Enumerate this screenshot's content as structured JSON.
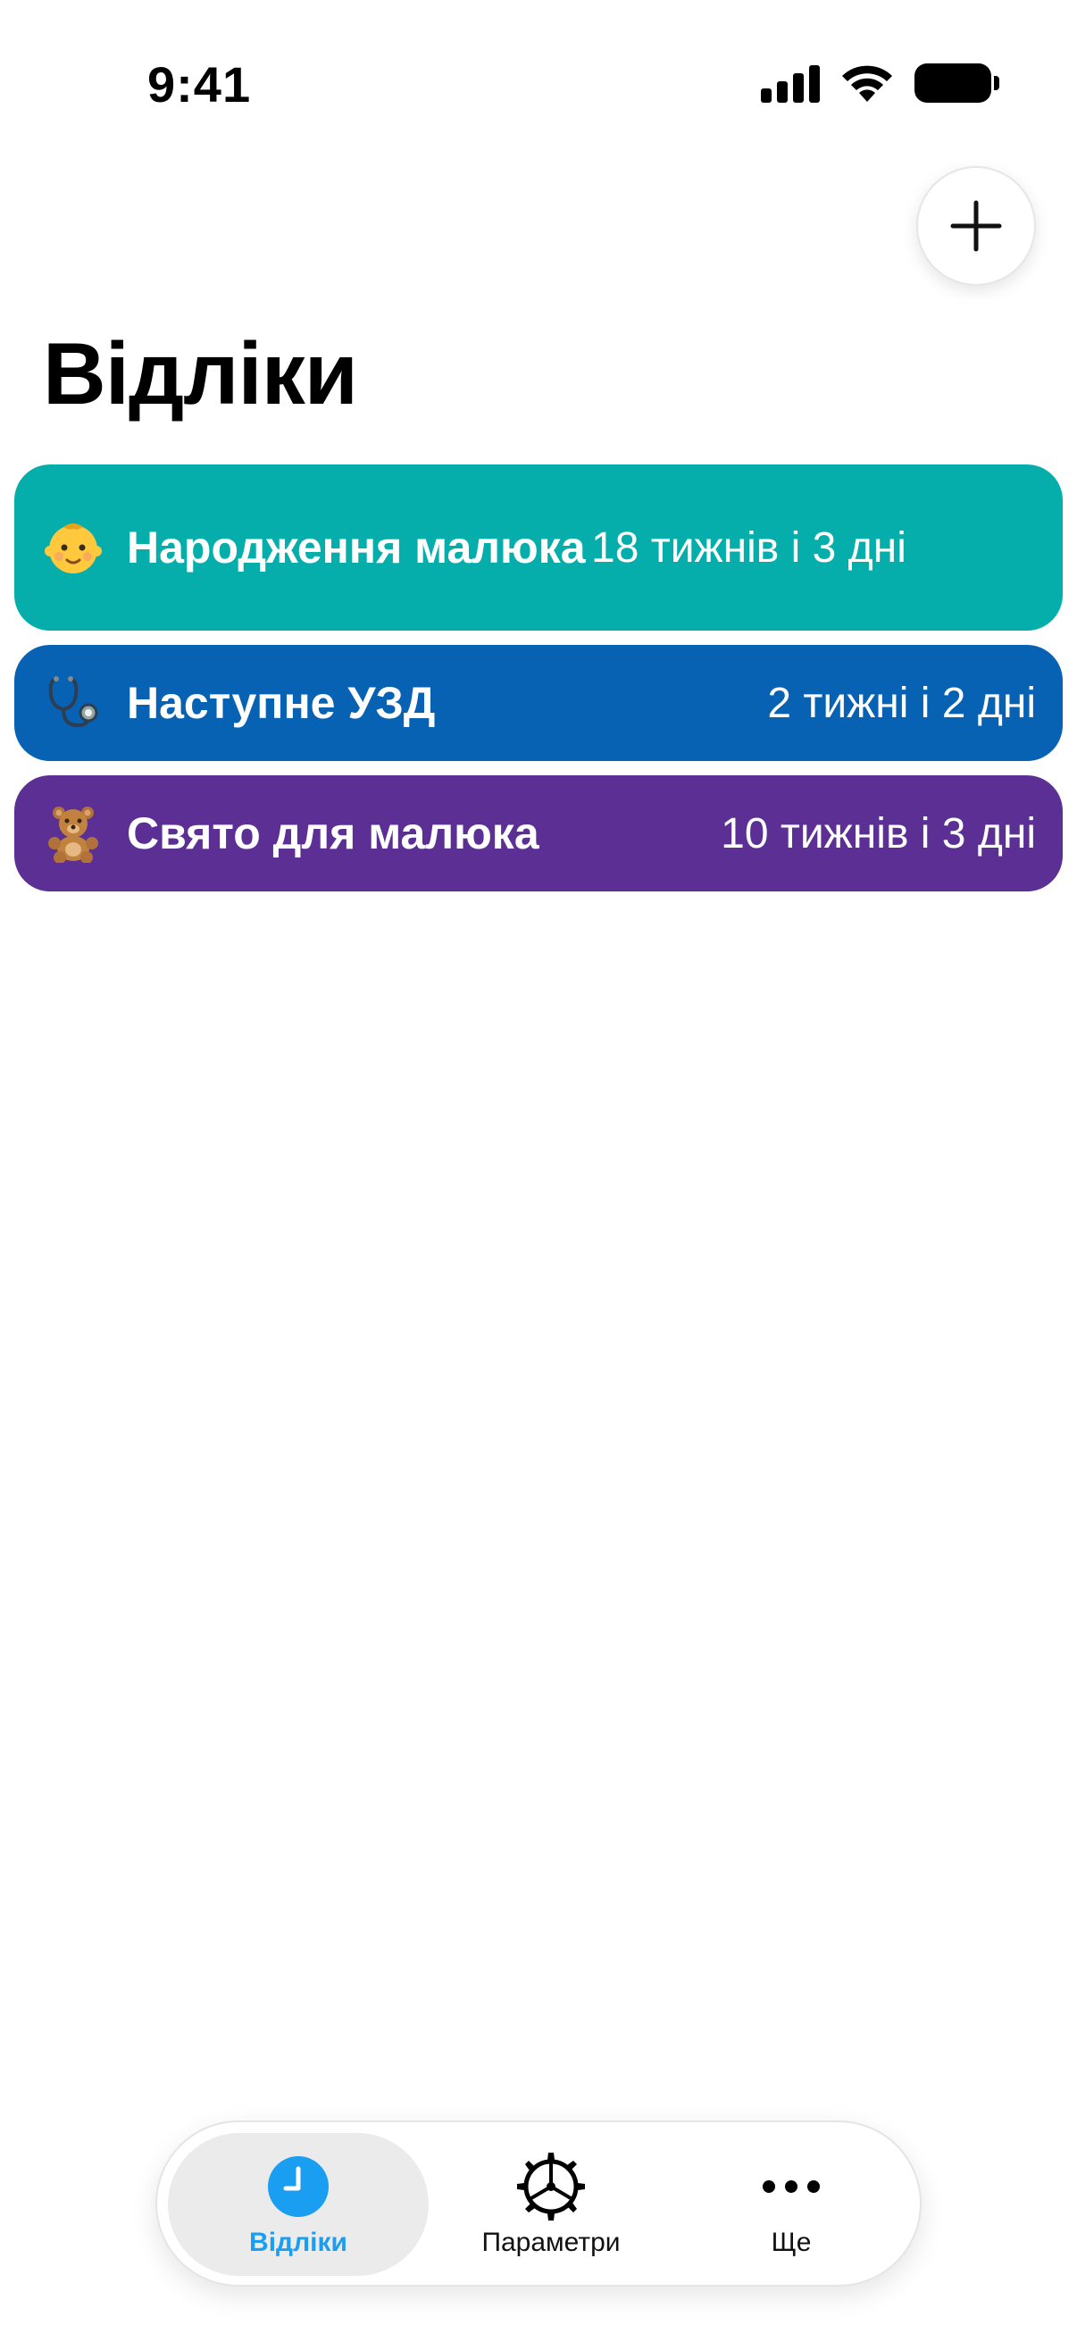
{
  "status_bar": {
    "time": "9:41",
    "icons": [
      "cellular-signal-icon",
      "wifi-icon",
      "battery-icon"
    ]
  },
  "header": {
    "add_button_icon": "plus-icon",
    "title": "Відліки"
  },
  "countdowns": [
    {
      "emoji": "👶",
      "name": "Народження малюка",
      "remaining": "18 тижнів і 3 дні",
      "color": "#05AEAB"
    },
    {
      "emoji": "🩺",
      "name": "Наступне УЗД",
      "remaining": "2 тижні і 2 дні",
      "color": "#0762B3"
    },
    {
      "emoji": "🧸",
      "name": "Свято для малюка",
      "remaining": "10 тижнів і 3 дні",
      "color": "#5B2F93"
    }
  ],
  "tab_bar": {
    "tabs": [
      {
        "label": "Відліки",
        "icon": "clock-icon",
        "selected": true
      },
      {
        "label": "Параметри",
        "icon": "gear-icon",
        "selected": false
      },
      {
        "label": "Ще",
        "icon": "ellipsis-icon",
        "selected": false
      }
    ],
    "accent_color": "#1A9EF2"
  }
}
